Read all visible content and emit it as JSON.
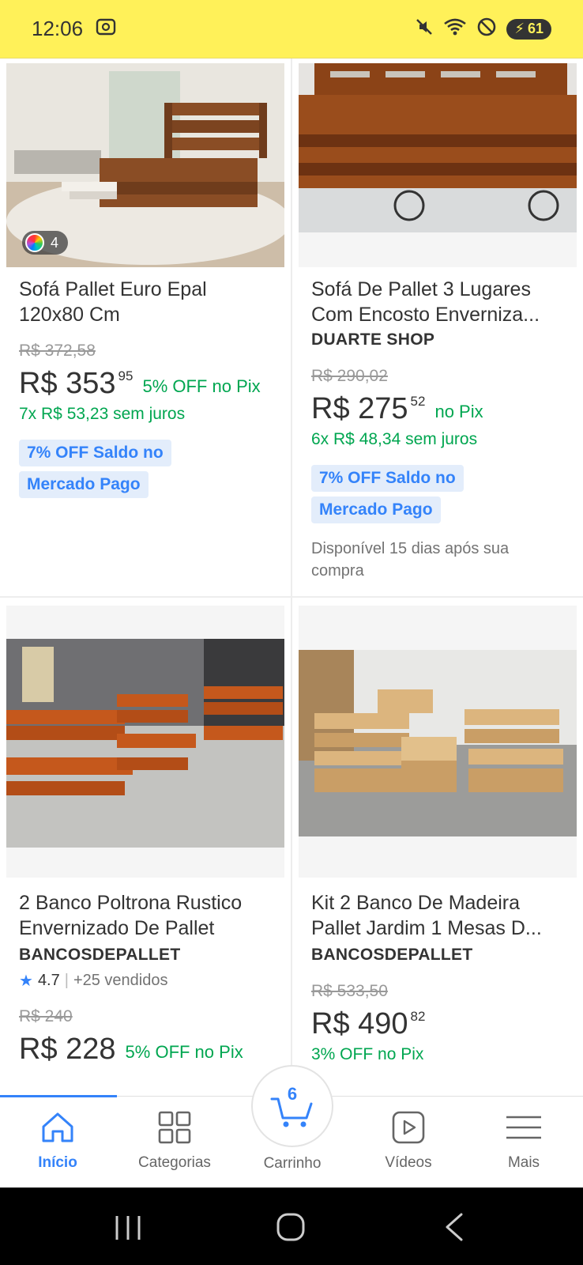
{
  "status_bar": {
    "time": "12:06",
    "battery": "61",
    "icons": [
      "screenshot-icon",
      "mute-icon",
      "wifi-icon",
      "dnd-icon",
      "battery-icon"
    ]
  },
  "products": [
    {
      "title": "Sofá Pallet Euro Epal 120x80 Cm",
      "title_line1": "Sofá Pallet Euro Epal",
      "title_line2": "120x80 Cm",
      "color_count": "4",
      "old_price": "R$ 372,58",
      "price_main": "R$ 353",
      "price_cents": "95",
      "pix": "5% OFF no Pix",
      "installments": "7x R$ 53,23 sem juros",
      "badge_line1": "7% OFF Saldo no",
      "badge_line2": "Mercado Pago"
    },
    {
      "title_line1": "Sofá De Pallet 3 Lugares",
      "title_line2": "Com Encosto Enverniza...",
      "seller": "DUARTE SHOP",
      "old_price": "R$ 290,02",
      "price_main": "R$ 275",
      "price_cents": "52",
      "pix": "no Pix",
      "installments": "6x R$ 48,34 sem juros",
      "badge_line1": "7% OFF Saldo no",
      "badge_line2": "Mercado Pago",
      "availability_line1": "Disponível 15 dias após sua",
      "availability_line2": "compra"
    },
    {
      "title_line1": "2 Banco Poltrona Rustico",
      "title_line2": "Envernizado De Pallet",
      "seller": "BANCOSDEPALLET",
      "rating": "4.7",
      "sold": "+25 vendidos",
      "old_price": "R$ 240",
      "price_main": "R$ 228",
      "pix": "5% OFF no Pix"
    },
    {
      "title_line1": "Kit 2 Banco De Madeira",
      "title_line2": "Pallet Jardim 1 Mesas D...",
      "seller": "BANCOSDEPALLET",
      "old_price": "R$ 533,50",
      "price_main": "R$ 490",
      "price_cents": "82",
      "pix": "3% OFF no Pix"
    }
  ],
  "nav": {
    "home": "Início",
    "categories": "Categorias",
    "cart": "Carrinho",
    "cart_count": "6",
    "videos": "Vídeos",
    "more": "Mais"
  },
  "colors": {
    "brand_yellow": "#fff159",
    "accent_blue": "#3483fa",
    "pix_green": "#00a650"
  }
}
